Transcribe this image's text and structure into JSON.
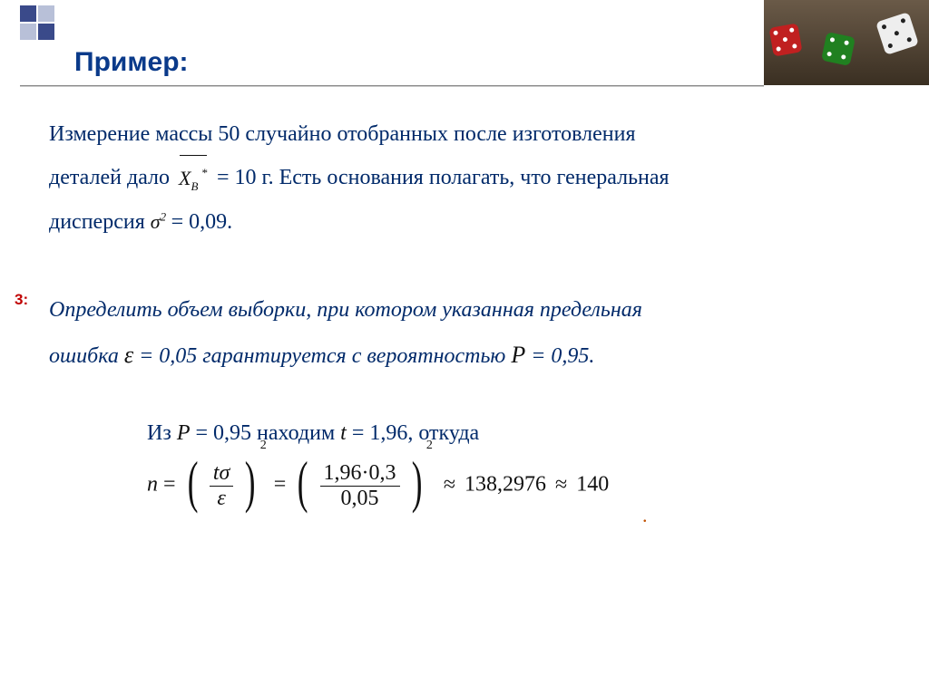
{
  "slide": {
    "title": "Пример:"
  },
  "intro": {
    "line1a": "Измерение массы 50 случайно отобранных после изготовления",
    "line2a": "деталей дало ",
    "xb_sym": "X",
    "xb_sub": "В",
    "xb_sup": "*",
    "line2b": " = 10 г. Есть основания полагать, что генеральная",
    "line3a": "дисперсия ",
    "sigma": "σ",
    "sigma_sup": "2",
    "line3b": " = 0,09."
  },
  "task_label": "3:",
  "task": {
    "l1": "Определить объем выборки, при котором указанная предельная",
    "l2a": "ошибка ",
    "eps": "ε",
    "l2b": " = 0,05 гарантируется с вероятностью ",
    "P": "P",
    "l2c": " = 0,95."
  },
  "solution": {
    "from": "Из ",
    "P": "P",
    "eqP": " = 0,95 находим ",
    "t": "t",
    "eqT": " = 1,96, откуда"
  },
  "formula": {
    "n": "n",
    "eq": "=",
    "num1": "tσ",
    "den1": "ε",
    "exp": "2",
    "num2": "1,96·0,3",
    "den2": "0,05",
    "approx": "≈",
    "val1": "138,2976",
    "val2": "140"
  },
  "period": "."
}
